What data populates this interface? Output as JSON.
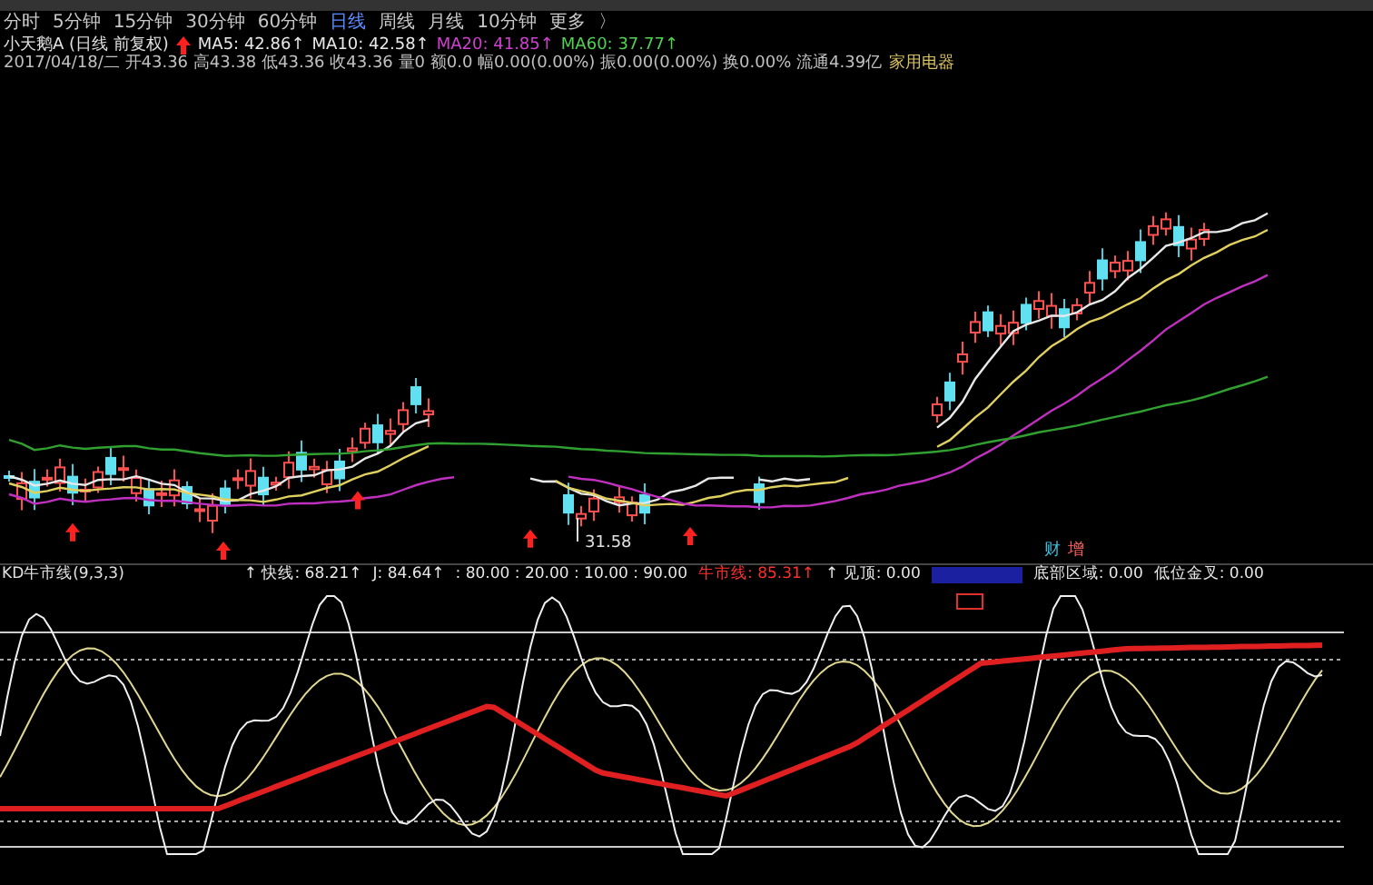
{
  "period_tabs": [
    {
      "label": "分时",
      "selected": false
    },
    {
      "label": "5分钟",
      "selected": false
    },
    {
      "label": "15分钟",
      "selected": false
    },
    {
      "label": "30分钟",
      "selected": false
    },
    {
      "label": "60分钟",
      "selected": false
    },
    {
      "label": "日线",
      "selected": true
    },
    {
      "label": "周线",
      "selected": false
    },
    {
      "label": "月线",
      "selected": false
    },
    {
      "label": "10分钟",
      "selected": false
    },
    {
      "label": "更多",
      "selected": false
    }
  ],
  "more_arrow": "〉",
  "quote": {
    "name": "小天鹅A (日线 前复权)",
    "moving_averages": [
      {
        "label": "MA5: 42.86↑",
        "color": "#e8e8e8"
      },
      {
        "label": "MA10: 42.58↑",
        "color": "#e8e8e8"
      },
      {
        "label": "MA20: 41.85↑",
        "color": "#d040d0"
      },
      {
        "label": "MA60: 37.77↑",
        "color": "#50d050"
      }
    ],
    "detail": "2017/04/18/二 开43.36 高43.38 低43.36 收43.36 量0 额0.0 幅0.00(0.00%) 振0.00(0.00%) 换0.00% 流通4.39亿",
    "sector": "家用电器"
  },
  "main_chart": {
    "low_label": "31.58",
    "markers": [
      {
        "text": "财",
        "color": "#40c0e0"
      },
      {
        "text": "增",
        "color": "#ff6060"
      }
    ]
  },
  "indicator": {
    "title": "KD牛市线(9,3,3)",
    "values": [
      {
        "text": "↑ 快线: 68.21↑",
        "color": "#e8e8e8"
      },
      {
        "text": "J: 84.64↑",
        "color": "#e8e8e8"
      },
      {
        "text": ": 80.00 : 20.00 : 10.00 : 90.00",
        "color": "#e8e8e8"
      },
      {
        "text": "牛市线: 85.31↑",
        "color": "#ff3030"
      },
      {
        "text": "↑ 见顶: 0.00",
        "color": "#e8e8e8"
      },
      {
        "text": "底部区域: 0.00",
        "color": "#e8e8e8"
      },
      {
        "text": "低位金叉: 0.00",
        "color": "#e8e8e8"
      }
    ]
  }
}
